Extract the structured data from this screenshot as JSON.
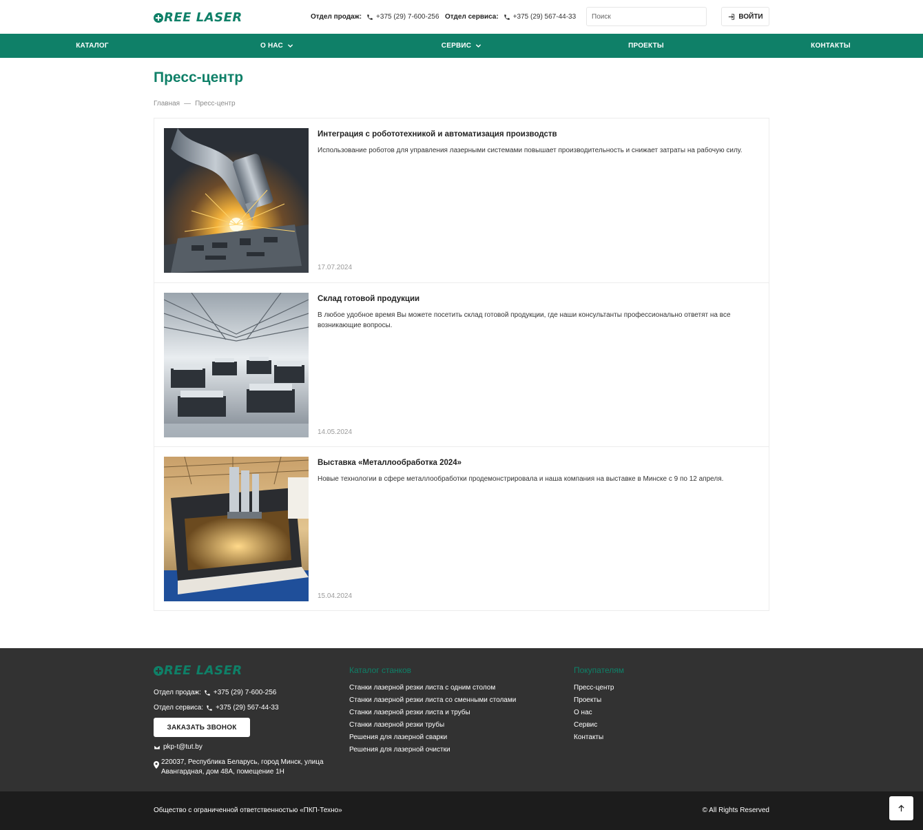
{
  "brand": {
    "logo_text": "REE LASER",
    "accent": "#0f8068"
  },
  "header": {
    "sales_label": "Отдел продаж:",
    "sales_phone": "+375 (29) 7-600-256",
    "service_label": "Отдел сервиса:",
    "service_phone": "+375 (29) 567-44-33",
    "search_placeholder": "Поиск",
    "login_label": "ВОЙТИ"
  },
  "nav": [
    {
      "label": "КАТАЛОГ",
      "dropdown": false
    },
    {
      "label": "О НАС",
      "dropdown": true
    },
    {
      "label": "СЕРВИС",
      "dropdown": true
    },
    {
      "label": "ПРОЕКТЫ",
      "dropdown": false
    },
    {
      "label": "КОНТАКТЫ",
      "dropdown": false
    }
  ],
  "page": {
    "title": "Пресс-центр",
    "breadcrumb": {
      "home": "Главная",
      "separator": "—",
      "current": "Пресс-центр"
    }
  },
  "news": [
    {
      "title": "Интеграция с робототехникой и автоматизация производств",
      "description": "Использование роботов для управления лазерными системами повышает производительность и снижает затраты на рабочую силу.",
      "date": "17.07.2024"
    },
    {
      "title": "Склад готовой продукции",
      "description": "В любое удобное время Вы можете посетить склад готовой продукции, где наши консультанты профессионально ответят на все возникающие вопросы.",
      "date": "14.05.2024"
    },
    {
      "title": "Выставка «Металлообработка 2024»",
      "description": "Новые технологии в сфере металлообработки продемонстрировала и наша компания на выставке в Минске с 9 по 12 апреля.",
      "date": "15.04.2024"
    }
  ],
  "footer": {
    "sales_label": "Отдел продаж:",
    "sales_phone": "+375 (29) 7-600-256",
    "service_label": "Отдел сервиса:",
    "service_phone": "+375 (29) 567-44-33",
    "callback_label": "ЗАКАЗАТЬ ЗВОНОК",
    "email": "pkp-t@tut.by",
    "address": "220037, Республика Беларусь, город Минск, улица Авангардная, дом 48А, помещение 1Н",
    "catalog_title": "Каталог станков",
    "catalog_links": [
      "Станки лазерной резки листа с одним столом",
      "Станки лазерной резки листа со сменными столами",
      "Станки лазерной резки листа и трубы",
      "Станки лазерной резки трубы",
      "Решения для лазерной сварки",
      "Решения для лазерной очистки"
    ],
    "buyers_title": "Покупателям",
    "buyers_links": [
      "Пресс-центр",
      "Проекты",
      "О нас",
      "Сервис",
      "Контакты"
    ],
    "company": "Общество с ограниченной ответственностью «ПКП-Техно»",
    "rights": "© All Rights Reserved"
  }
}
